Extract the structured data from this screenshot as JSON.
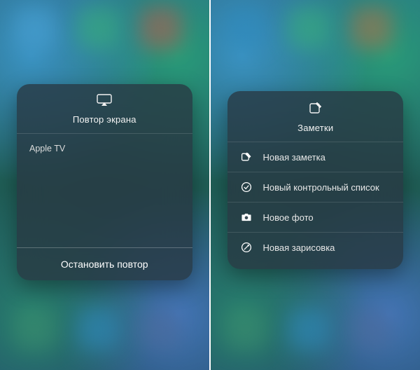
{
  "left": {
    "title": "Повтор экрана",
    "device": "Apple TV",
    "stop_label": "Остановить повтор"
  },
  "right": {
    "title": "Заметки",
    "actions": [
      {
        "icon": "compose-icon",
        "label": "Новая заметка"
      },
      {
        "icon": "checklist-icon",
        "label": "Новый контрольный список"
      },
      {
        "icon": "camera-icon",
        "label": "Новое фото"
      },
      {
        "icon": "sketch-icon",
        "label": "Новая зарисовка"
      }
    ]
  }
}
